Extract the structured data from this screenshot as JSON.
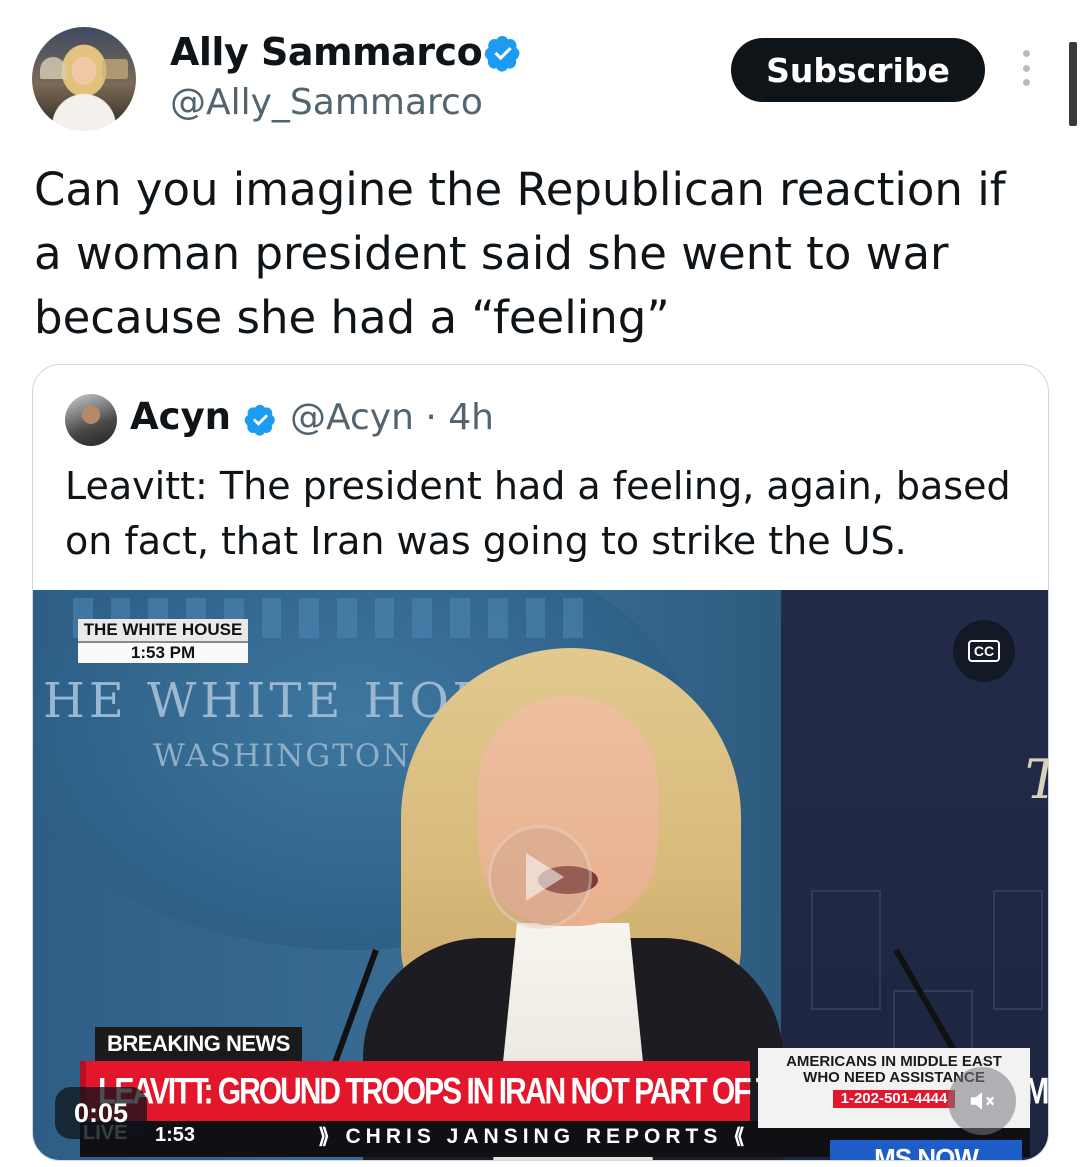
{
  "author": {
    "name": "Ally Sammarco",
    "handle": "@Ally_Sammarco",
    "verified": true
  },
  "actions": {
    "subscribe_label": "Subscribe",
    "more_icon": "more-vertical-icon"
  },
  "tweet": {
    "text": "Can you imagine the Republican reaction if a woman president said she went to war because she had a “feeling”"
  },
  "quoted": {
    "name": "Acyn",
    "handle": "@Acyn",
    "time": "· 4h",
    "verified": true,
    "text": "Leavitt: The president had a feeling, again, based on fact, that Iran was going to strike the US."
  },
  "video": {
    "location_badge": "THE WHITE HOUSE",
    "location_time": "1:53 PM",
    "backdrop_text": "HE WHITE HOU",
    "backdrop_sub": "WASHINGTON",
    "backdrop_right": "T",
    "breaking_label": "BREAKING NEWS",
    "headline": "LEAVITT: GROUND TROOPS IN IRAN NOT PART OF THE PLAN AT THIS TIME",
    "live_label": "LIVE",
    "live_time": "1:53",
    "show_name": "⟫ CHRIS JANSING REPORTS ⟪",
    "info_line1": "AMERICANS IN MIDDLE EAST",
    "info_line2": "WHO NEED ASSISTANCE",
    "info_phone": "1-202-501-4444",
    "network": "MS NOW",
    "elapsed": "0:05",
    "cc_label": "CC",
    "accent_red": "#e2172c",
    "network_blue": "#1e5cc8"
  },
  "colors": {
    "text_primary": "#0f1419",
    "text_secondary": "#536471",
    "verified_blue": "#1d9bf0",
    "border": "#cfd9de"
  }
}
